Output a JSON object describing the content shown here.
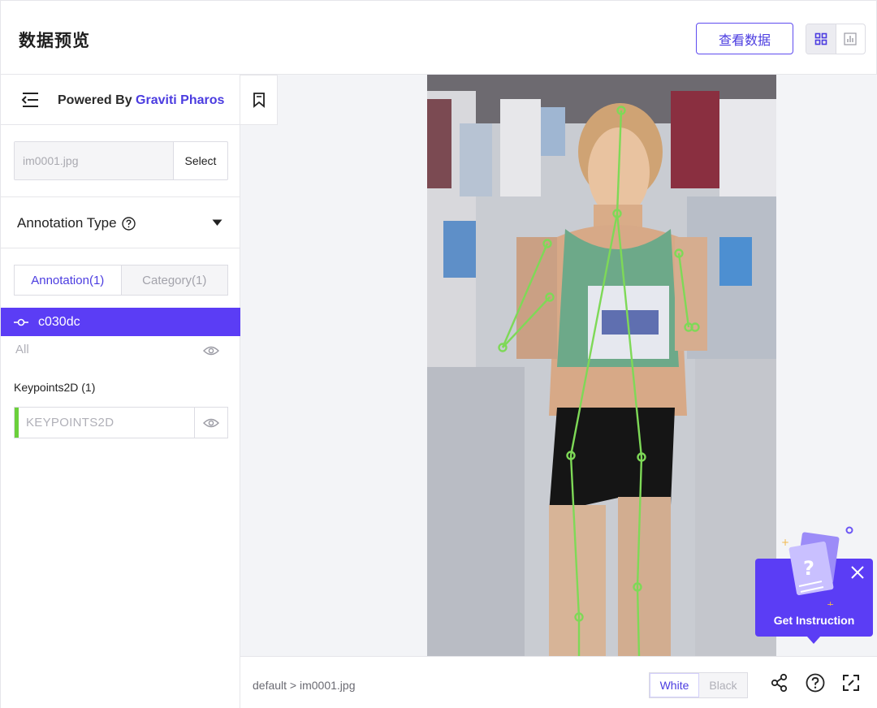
{
  "header": {
    "title": "数据预览",
    "view_data_button": "查看数据",
    "view_toggle": {
      "grid_icon": "grid-icon",
      "chart_icon": "bar-chart-icon",
      "active": "grid"
    }
  },
  "sidebar": {
    "collapse_icon": "collapse-left-icon",
    "powered_by": "Powered By",
    "brand": "Graviti Pharos",
    "file_input_value": "im0001.jpg",
    "select_button": "Select",
    "annotation_type_label": "Annotation Type",
    "annotation_type_help_icon": "question-circle-icon",
    "tabs": [
      {
        "label": "Annotation(1)",
        "active": true
      },
      {
        "label": "Category(1)",
        "active": false
      }
    ],
    "selected_annotation": {
      "icon": "keypoint-icon",
      "label": "c030dc"
    },
    "all_label": "All",
    "group_label": "Keypoints2D (1)",
    "group_item": {
      "label": "KEYPOINTS2D",
      "color": "#6bd03b"
    }
  },
  "canvas": {
    "bookmark_icon": "bookmark-icon",
    "keypoint_color": "#7ed957"
  },
  "footer": {
    "breadcrumb": "default > im0001.jpg",
    "bg_options": [
      {
        "label": "White",
        "active": true
      },
      {
        "label": "Black",
        "active": false
      }
    ],
    "icons": [
      "share-icon",
      "help-circle-icon",
      "fullscreen-icon"
    ]
  },
  "instruction": {
    "label": "Get Instruction",
    "close_icon": "close-icon"
  },
  "colors": {
    "accent": "#5b3df5",
    "border": "#e6e6ea",
    "canvas_bg": "#f3f4f7"
  }
}
